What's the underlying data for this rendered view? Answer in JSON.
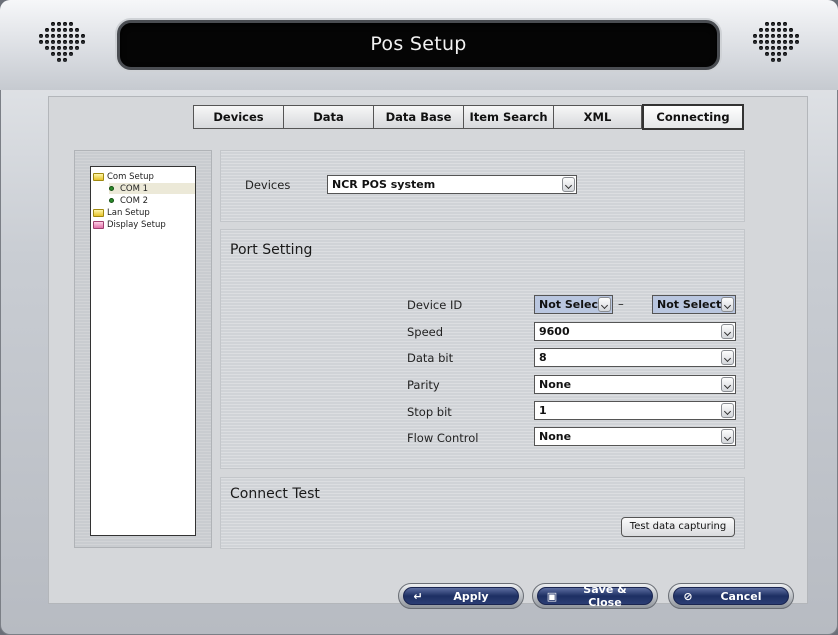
{
  "window": {
    "title": "Pos Setup"
  },
  "tabs": [
    {
      "label": "Devices"
    },
    {
      "label": "Data"
    },
    {
      "label": "Data Base"
    },
    {
      "label": "Item Search"
    },
    {
      "label": "XML"
    },
    {
      "label": "Connecting",
      "active": true
    }
  ],
  "tree": {
    "items": [
      {
        "label": "Com Setup",
        "icon": "folder-yellow-icon"
      },
      {
        "label": "COM 1",
        "icon": "bullet-icon",
        "selected": true
      },
      {
        "label": "COM 2",
        "icon": "bullet-icon"
      },
      {
        "label": "Lan Setup",
        "icon": "folder-yellow-icon"
      },
      {
        "label": "Display Setup",
        "icon": "folder-pink-icon"
      }
    ]
  },
  "devices": {
    "label": "Devices",
    "value": "NCR POS system"
  },
  "port_setting": {
    "title": "Port Setting",
    "device_id": {
      "label": "Device ID",
      "from": "Not Select",
      "separator": "–",
      "to": "Not Select"
    },
    "speed": {
      "label": "Speed",
      "value": "9600"
    },
    "data_bit": {
      "label": "Data bit",
      "value": "8"
    },
    "parity": {
      "label": "Parity",
      "value": "None"
    },
    "stop_bit": {
      "label": "Stop bit",
      "value": "1"
    },
    "flow_control": {
      "label": "Flow Control",
      "value": "None"
    }
  },
  "connect_test": {
    "title": "Connect Test",
    "button": "Test data capturing"
  },
  "footer": {
    "apply": {
      "label": "Apply",
      "icon": "↵"
    },
    "save_close": {
      "label": "Save & Close",
      "icon": "▣"
    },
    "cancel": {
      "label": "Cancel",
      "icon": "⊘"
    }
  },
  "colors": {
    "title_bar": "#050505",
    "button_blue": "#1d2f63",
    "select_highlight": "#b9c6df"
  }
}
